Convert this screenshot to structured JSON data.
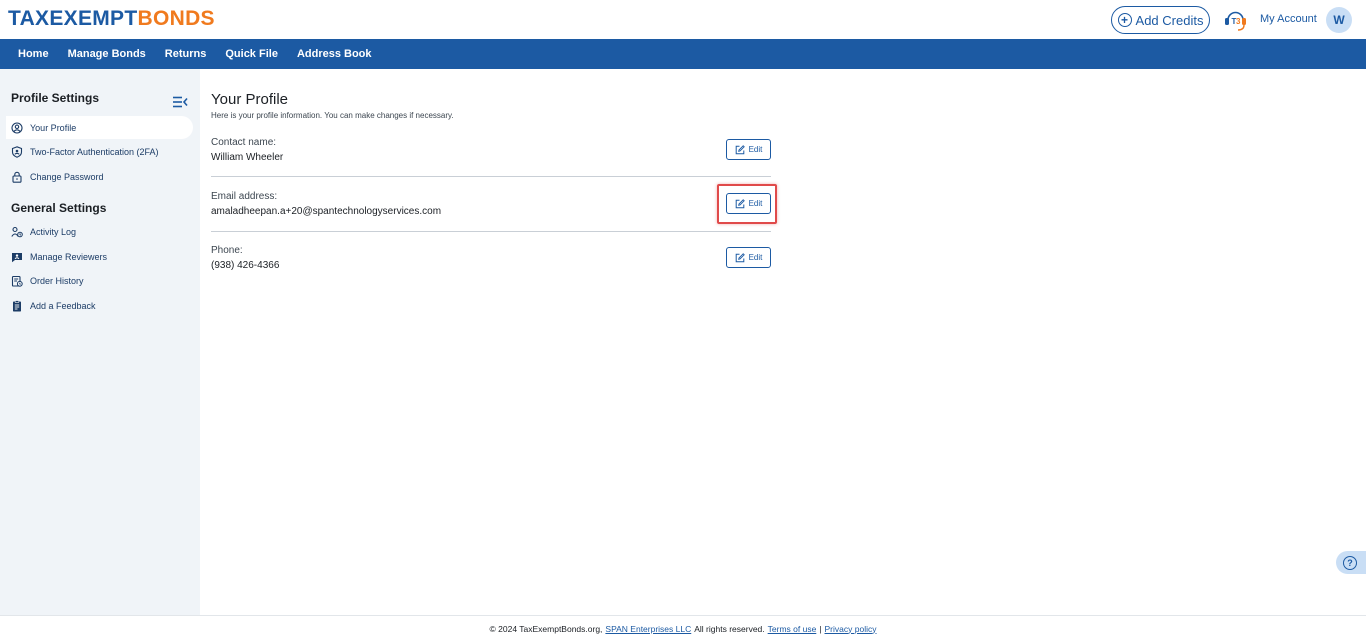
{
  "brand": {
    "logo_part1": "TAXEXEMPT",
    "logo_part2": "BONDS",
    "colors": {
      "primary": "#1c5aa3",
      "accent": "#f07a1e",
      "highlight": "#e04a4a"
    }
  },
  "header": {
    "add_credits_label": "Add Credits",
    "t3_icon_label": "T3",
    "my_account_label": "My Account",
    "avatar_initial": "W"
  },
  "nav": {
    "items": [
      "Home",
      "Manage Bonds",
      "Returns",
      "Quick File",
      "Address Book"
    ]
  },
  "sidebar": {
    "profile_heading": "Profile Settings",
    "profile_items": [
      {
        "label": "Your Profile",
        "icon": "user-circle-icon",
        "active": true
      },
      {
        "label": "Two-Factor Authentication (2FA)",
        "icon": "shield-user-icon"
      },
      {
        "label": "Change Password",
        "icon": "lock-icon"
      }
    ],
    "general_heading": "General Settings",
    "general_items": [
      {
        "label": "Activity Log",
        "icon": "activity-log-icon"
      },
      {
        "label": "Manage Reviewers",
        "icon": "reviewers-icon"
      },
      {
        "label": "Order History",
        "icon": "order-history-icon"
      },
      {
        "label": "Add a Feedback",
        "icon": "feedback-icon"
      }
    ]
  },
  "main": {
    "title": "Your Profile",
    "subtitle": "Here is your profile information. You can make changes if necessary.",
    "fields": [
      {
        "label": "Contact name:",
        "value": "William Wheeler",
        "edit_label": "Edit"
      },
      {
        "label": "Email address:",
        "value": "amaladheepan.a+20@spantechnologyservices.com",
        "edit_label": "Edit"
      },
      {
        "label": "Phone:",
        "value": "(938) 426-4366",
        "edit_label": "Edit"
      }
    ]
  },
  "help": {
    "label": "?"
  },
  "footer": {
    "copyright": "© 2024 TaxExemptBonds.org,",
    "company_link": "SPAN Enterprises LLC",
    "rights": "All rights reserved.",
    "terms_link": "Terms of use",
    "separator": "|",
    "privacy_link": "Privacy policy"
  }
}
